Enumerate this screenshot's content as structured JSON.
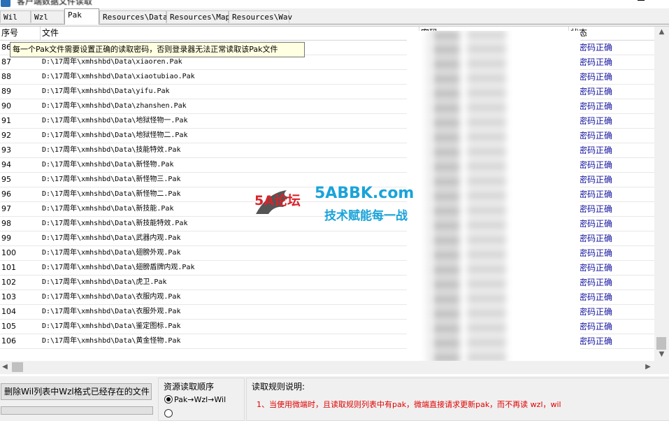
{
  "window": {
    "title": "客户端数据文件读取"
  },
  "tabs": [
    {
      "label": "Wil"
    },
    {
      "label": "Wzl"
    },
    {
      "label": "Pak"
    },
    {
      "label": "Resources\\Data"
    },
    {
      "label": "Resources\\Map"
    },
    {
      "label": "Resources\\Wav"
    }
  ],
  "table": {
    "columns": {
      "no": "序号",
      "file": "文件",
      "password": "密码",
      "status": "状态"
    },
    "tooltip": "每一个Pak文件需要设置正确的读取密码，否则登录器无法正常读取该Pak文件",
    "rows": [
      {
        "no": "86",
        "file": "",
        "status": "密码正确"
      },
      {
        "no": "87",
        "file": "D:\\17周年\\xmhshbd\\Data\\xiaoren.Pak",
        "status": "密码正确"
      },
      {
        "no": "88",
        "file": "D:\\17周年\\xmhshbd\\Data\\xiaotubiao.Pak",
        "status": "密码正确"
      },
      {
        "no": "89",
        "file": "D:\\17周年\\xmhshbd\\Data\\yifu.Pak",
        "status": "密码正确"
      },
      {
        "no": "90",
        "file": "D:\\17周年\\xmhshbd\\Data\\zhanshen.Pak",
        "status": "密码正确"
      },
      {
        "no": "91",
        "file": "D:\\17周年\\xmhshbd\\Data\\地狱怪物一.Pak",
        "status": "密码正确"
      },
      {
        "no": "92",
        "file": "D:\\17周年\\xmhshbd\\Data\\地狱怪物二.Pak",
        "status": "密码正确"
      },
      {
        "no": "93",
        "file": "D:\\17周年\\xmhshbd\\Data\\技能特效.Pak",
        "status": "密码正确"
      },
      {
        "no": "94",
        "file": "D:\\17周年\\xmhshbd\\Data\\新怪物.Pak",
        "status": "密码正确"
      },
      {
        "no": "95",
        "file": "D:\\17周年\\xmhshbd\\Data\\新怪物三.Pak",
        "status": "密码正确"
      },
      {
        "no": "96",
        "file": "D:\\17周年\\xmhshbd\\Data\\新怪物二.Pak",
        "status": "密码正确"
      },
      {
        "no": "97",
        "file": "D:\\17周年\\xmhshbd\\Data\\新技能.Pak",
        "status": "密码正确"
      },
      {
        "no": "98",
        "file": "D:\\17周年\\xmhshbd\\Data\\新技能特效.Pak",
        "status": "密码正确"
      },
      {
        "no": "99",
        "file": "D:\\17周年\\xmhshbd\\Data\\武器内观.Pak",
        "status": "密码正确"
      },
      {
        "no": "100",
        "file": "D:\\17周年\\xmhshbd\\Data\\翅膀外观.Pak",
        "status": "密码正确"
      },
      {
        "no": "101",
        "file": "D:\\17周年\\xmhshbd\\Data\\翅膀盾牌内观.Pak",
        "status": "密码正确"
      },
      {
        "no": "102",
        "file": "D:\\17周年\\xmhshbd\\Data\\虎卫.Pak",
        "status": "密码正确"
      },
      {
        "no": "103",
        "file": "D:\\17周年\\xmhshbd\\Data\\衣服内观.Pak",
        "status": "密码正确"
      },
      {
        "no": "104",
        "file": "D:\\17周年\\xmhshbd\\Data\\衣服外观.Pak",
        "status": "密码正确"
      },
      {
        "no": "105",
        "file": "D:\\17周年\\xmhshbd\\Data\\鉴定图标.Pak",
        "status": "密码正确"
      },
      {
        "no": "106",
        "file": "D:\\17周年\\xmhshbd\\Data\\黄金怪物.Pak",
        "status": "密码正确"
      }
    ]
  },
  "bottom": {
    "delete_button": "删除Wil列表中Wzl格式已经存在的文件",
    "order_group": "资源读取顺序",
    "order_option1": "Pak→Wzl→Wil",
    "rules_group": "读取规则说明:",
    "rule1": "1、当使用微端时，且读取规则列表中有pak，微端直接请求更新pak，而不再读 wzl，wil"
  },
  "watermark": {
    "brand": "5A论坛",
    "site": "5ABBK.com",
    "slogan": "技术赋能每一战"
  },
  "colors": {
    "status_text": "#1515a0",
    "rule_text": "#e00000",
    "tooltip_bg": "#ffffe1"
  }
}
